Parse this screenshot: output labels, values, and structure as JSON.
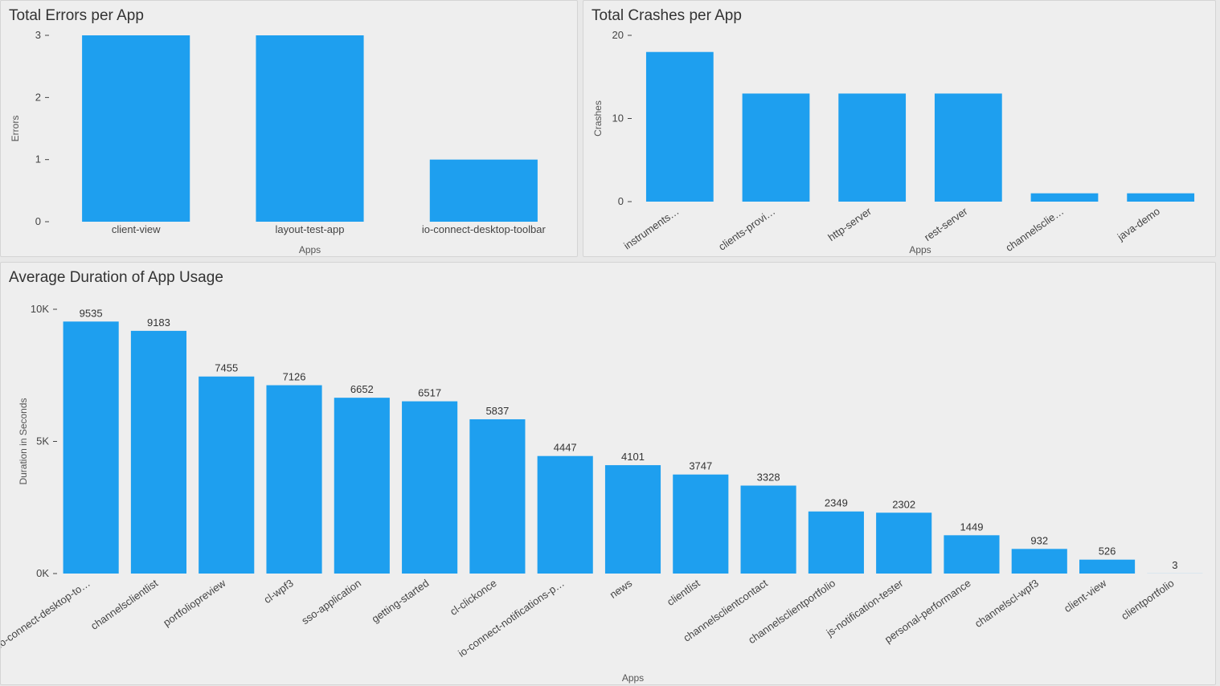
{
  "chart_data": [
    {
      "id": "errors",
      "type": "bar",
      "title": "Total Errors per App",
      "xlabel": "Apps",
      "ylabel": "Errors",
      "ylim": [
        0,
        3
      ],
      "yticks": [
        0,
        1,
        2,
        3
      ],
      "categories": [
        "client-view",
        "layout-test-app",
        "io-connect-desktop-toolbar"
      ],
      "values": [
        3,
        3,
        1
      ]
    },
    {
      "id": "crashes",
      "type": "bar",
      "title": "Total Crashes per App",
      "xlabel": "Apps",
      "ylabel": "Crashes",
      "ylim": [
        0,
        20
      ],
      "yticks": [
        0,
        10,
        20
      ],
      "categories": [
        "instruments…",
        "clients-provi…",
        "http-server",
        "rest-server",
        "channelsclie…",
        "java-demo"
      ],
      "values": [
        18,
        13,
        13,
        13,
        1,
        1
      ]
    },
    {
      "id": "duration",
      "type": "bar",
      "title": "Average Duration of App Usage",
      "xlabel": "Apps",
      "ylabel": "Duration in Seconds",
      "ylim": [
        0,
        10000
      ],
      "yticks": [
        0,
        5000,
        10000
      ],
      "ytick_labels": [
        "0K",
        "5K",
        "10K"
      ],
      "categories": [
        "io-connect-desktop-to…",
        "channelsclientlist",
        "portfoliopreview",
        "cl-wpf3",
        "sso-application",
        "getting-started",
        "cl-clickonce",
        "io-connect-notifications-p…",
        "news",
        "clientlist",
        "channelsclientcontact",
        "channelsclientportfolio",
        "js-notification-tester",
        "personal-performance",
        "channelscl-wpf3",
        "client-view",
        "clientportfolio"
      ],
      "values": [
        9535,
        9183,
        7455,
        7126,
        6652,
        6517,
        5837,
        4447,
        4101,
        3747,
        3328,
        2349,
        2302,
        1449,
        932,
        526,
        3
      ],
      "show_data_labels": true
    }
  ]
}
